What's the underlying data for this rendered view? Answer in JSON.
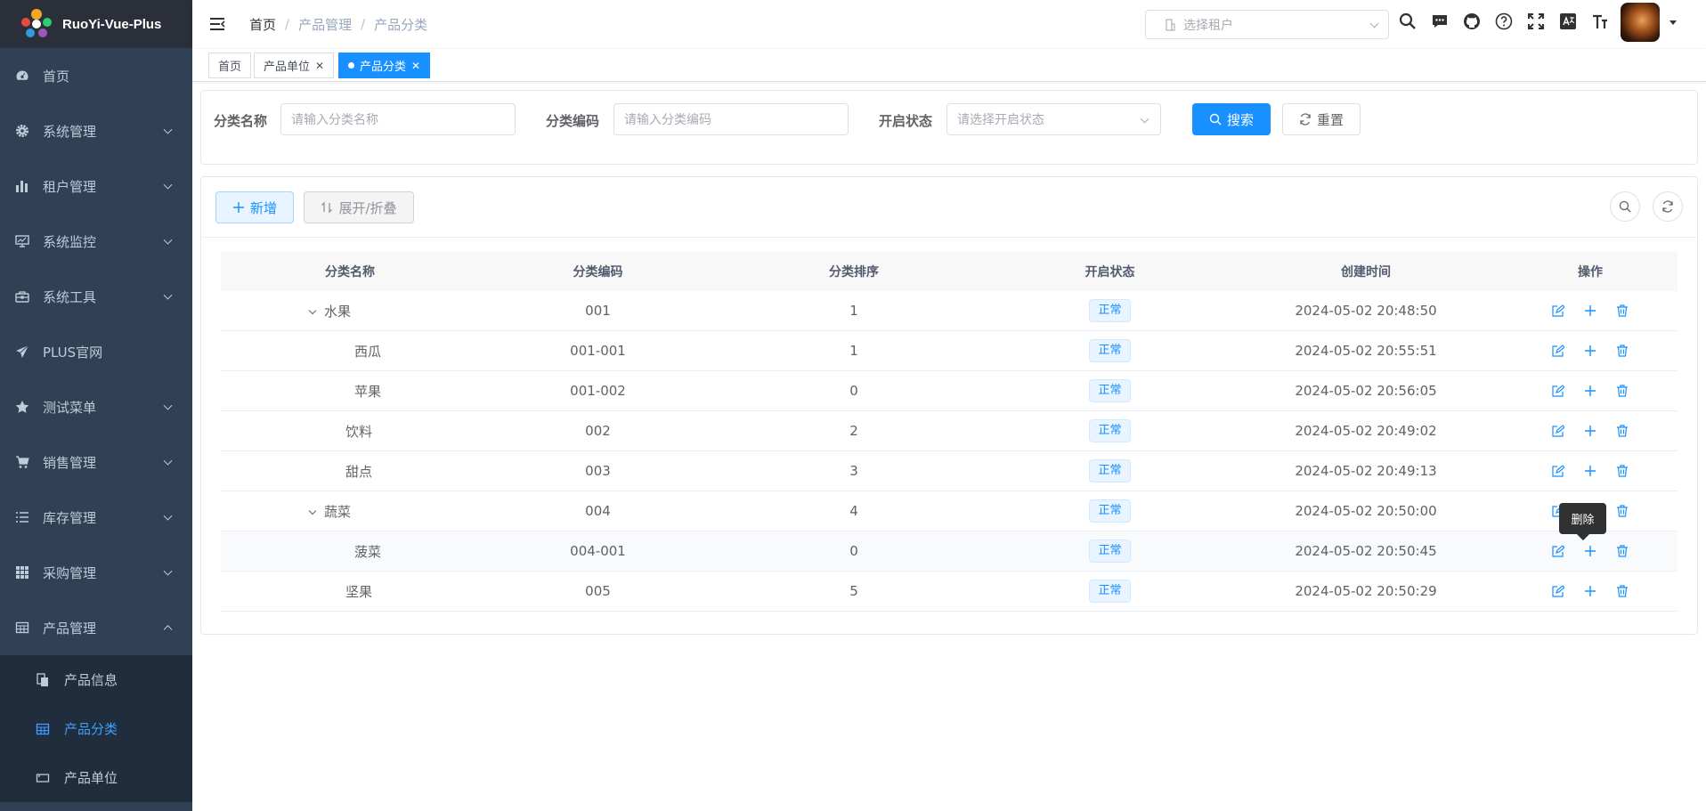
{
  "app": {
    "title": "RuoYi-Vue-Plus"
  },
  "sidebar": {
    "items": [
      {
        "label": "首页",
        "icon": "dashboard-icon"
      },
      {
        "label": "系统管理",
        "icon": "gear-icon"
      },
      {
        "label": "租户管理",
        "icon": "bar-chart-icon"
      },
      {
        "label": "系统监控",
        "icon": "monitor-icon"
      },
      {
        "label": "系统工具",
        "icon": "toolbox-icon"
      },
      {
        "label": "PLUS官网",
        "icon": "paper-plane-icon"
      },
      {
        "label": "测试菜单",
        "icon": "star-icon"
      },
      {
        "label": "销售管理",
        "icon": "cart-icon"
      },
      {
        "label": "库存管理",
        "icon": "list-icon"
      },
      {
        "label": "采购管理",
        "icon": "grid-icon"
      },
      {
        "label": "产品管理",
        "icon": "table-icon"
      }
    ],
    "submenu": [
      {
        "label": "产品信息",
        "icon": "documents-icon"
      },
      {
        "label": "产品分类",
        "icon": "table-icon"
      },
      {
        "label": "产品单位",
        "icon": "unit-icon"
      }
    ]
  },
  "header": {
    "breadcrumb": [
      "首页",
      "产品管理",
      "产品分类"
    ],
    "tenant_placeholder": "选择租户"
  },
  "tags": [
    {
      "label": "首页"
    },
    {
      "label": "产品单位"
    },
    {
      "label": "产品分类"
    }
  ],
  "search": {
    "name_label": "分类名称",
    "name_placeholder": "请输入分类名称",
    "code_label": "分类编码",
    "code_placeholder": "请输入分类编码",
    "status_label": "开启状态",
    "status_placeholder": "请选择开启状态",
    "search_btn": "搜索",
    "reset_btn": "重置"
  },
  "toolbar": {
    "add_btn": "新增",
    "expand_btn": "展开/折叠"
  },
  "table": {
    "columns": [
      "分类名称",
      "分类编码",
      "分类排序",
      "开启状态",
      "创建时间",
      "操作"
    ],
    "rows": [
      {
        "name": "水果",
        "code": "001",
        "sort": "1",
        "status": "正常",
        "time": "2024-05-02 20:48:50"
      },
      {
        "name": "西瓜",
        "code": "001-001",
        "sort": "1",
        "status": "正常",
        "time": "2024-05-02 20:55:51"
      },
      {
        "name": "苹果",
        "code": "001-002",
        "sort": "0",
        "status": "正常",
        "time": "2024-05-02 20:56:05"
      },
      {
        "name": "饮料",
        "code": "002",
        "sort": "2",
        "status": "正常",
        "time": "2024-05-02 20:49:02"
      },
      {
        "name": "甜点",
        "code": "003",
        "sort": "3",
        "status": "正常",
        "time": "2024-05-02 20:49:13"
      },
      {
        "name": "蔬菜",
        "code": "004",
        "sort": "4",
        "status": "正常",
        "time": "2024-05-02 20:50:00"
      },
      {
        "name": "菠菜",
        "code": "004-001",
        "sort": "0",
        "status": "正常",
        "time": "2024-05-02 20:50:45"
      },
      {
        "name": "坚果",
        "code": "005",
        "sort": "5",
        "status": "正常",
        "time": "2024-05-02 20:50:29"
      }
    ]
  },
  "tooltip": {
    "text": "删除"
  },
  "colors": {
    "primary": "#1890ff",
    "sidebar": "#304156",
    "submenu": "#1f2d3d"
  }
}
